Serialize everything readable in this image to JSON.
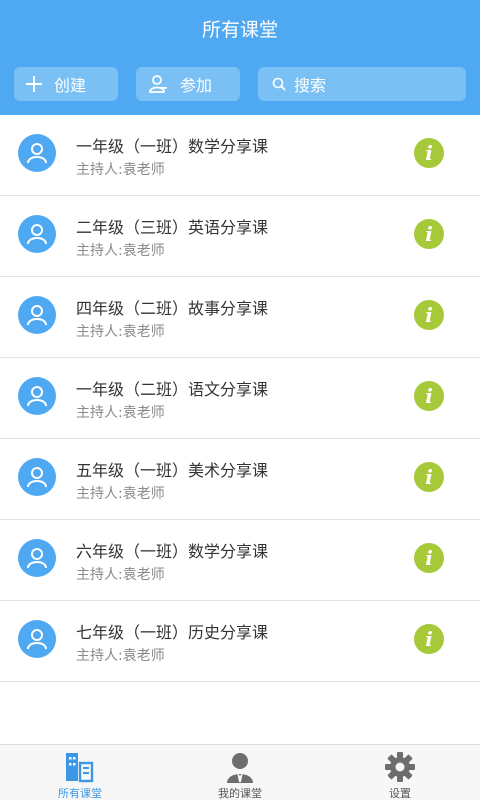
{
  "header": {
    "title": "所有课堂",
    "create_label": "创建",
    "join_label": "参加",
    "search_label": "搜索"
  },
  "classes": [
    {
      "title": "一年级（一班）数学分享课",
      "host": "主持人:袁老师"
    },
    {
      "title": "二年级（三班）英语分享课",
      "host": "主持人:袁老师"
    },
    {
      "title": "四年级（二班）故事分享课",
      "host": "主持人:袁老师"
    },
    {
      "title": "一年级（二班）语文分享课",
      "host": "主持人:袁老师"
    },
    {
      "title": "五年级（一班）美术分享课",
      "host": "主持人:袁老师"
    },
    {
      "title": "六年级（一班）数学分享课",
      "host": "主持人:袁老师"
    },
    {
      "title": "七年级（一班）历史分享课",
      "host": "主持人:袁老师"
    }
  ],
  "info_glyph": "i",
  "tabs": [
    {
      "label": "所有课堂",
      "icon": "classroom-icon",
      "active": true
    },
    {
      "label": "我的课堂",
      "icon": "person-icon",
      "active": false
    },
    {
      "label": "设置",
      "icon": "gear-icon",
      "active": false
    }
  ],
  "colors": {
    "primary": "#4FA8F2",
    "button_bg": "#7BC0F5",
    "info_badge": "#A6C93A",
    "active_tab": "#3C97E6"
  }
}
